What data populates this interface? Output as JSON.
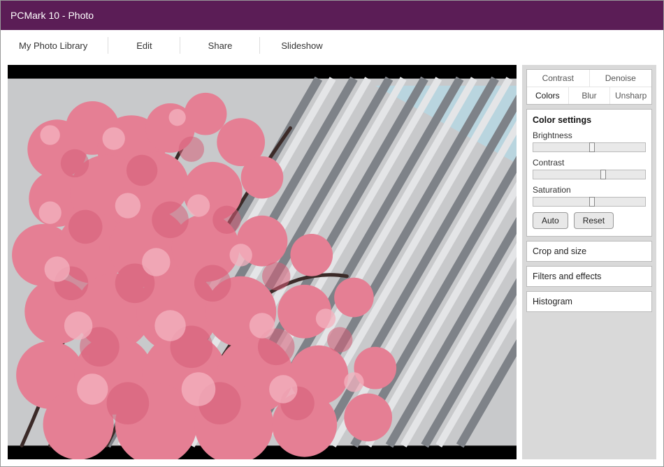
{
  "title": "PCMark 10 - Photo",
  "menu": {
    "items": [
      "My Photo Library",
      "Edit",
      "Share",
      "Slideshow"
    ]
  },
  "sidebar": {
    "tabs_row1": [
      "Contrast",
      "Denoise"
    ],
    "tabs_row2": [
      "Colors",
      "Blur",
      "Unsharp"
    ],
    "active_tab": "Colors",
    "settings_title": "Color settings",
    "sliders": [
      {
        "label": "Brightness",
        "pos": 50
      },
      {
        "label": "Contrast",
        "pos": 60
      },
      {
        "label": "Saturation",
        "pos": 50
      }
    ],
    "auto_label": "Auto",
    "reset_label": "Reset",
    "panels": [
      "Crop and size",
      "Filters and effects",
      "Histogram"
    ]
  }
}
